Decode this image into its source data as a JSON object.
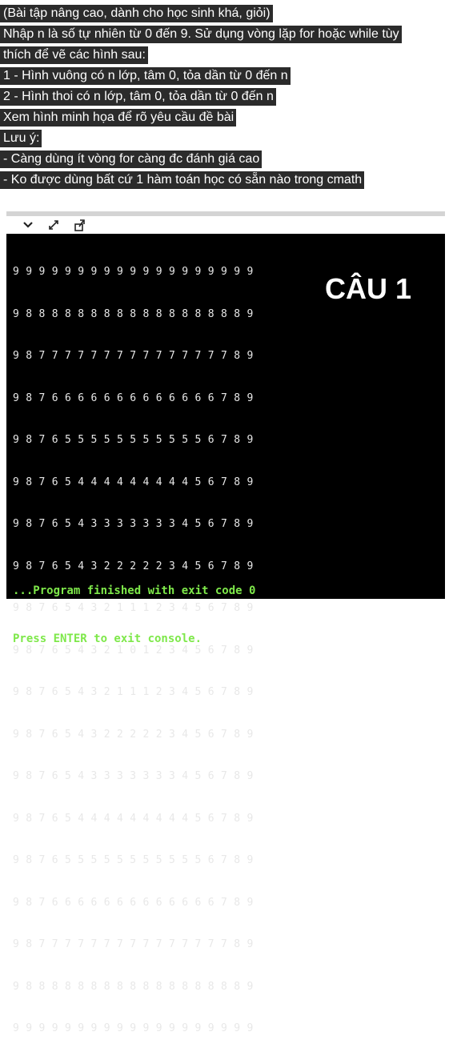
{
  "task": {
    "lines": [
      "(Bài tập nâng cao, dành cho học sinh khá, giỏi)",
      "Nhập n là số tự nhiên từ 0 đến 9. Sử dụng vòng lặp for hoặc while tùy",
      "thích để vẽ các hình sau:",
      "1 - Hình vuông có n lớp, tâm 0, tỏa dần từ 0 đến n",
      "2 - Hình thoi có n lớp, tâm 0, tỏa dần từ 0 đến n",
      "Xem hình minh họa để rõ yêu cầu đề bài",
      "Lưu ý:",
      "- Càng dùng ít vòng for càng đc đánh giá cao",
      "- Ko được dùng bất cứ 1 hàm toán học có sẵn nào trong cmath"
    ]
  },
  "toolbar": {
    "icons": [
      "chevron-down-icon",
      "expand-icon",
      "export-icon"
    ]
  },
  "console": {
    "label": "CÂU 1",
    "rows": [
      "9 9 9 9 9 9 9 9 9 9 9 9 9 9 9 9 9 9 9",
      "9 8 8 8 8 8 8 8 8 8 8 8 8 8 8 8 8 8 9",
      "9 8 7 7 7 7 7 7 7 7 7 7 7 7 7 7 7 8 9",
      "9 8 7 6 6 6 6 6 6 6 6 6 6 6 6 6 7 8 9",
      "9 8 7 6 5 5 5 5 5 5 5 5 5 5 5 6 7 8 9",
      "9 8 7 6 5 4 4 4 4 4 4 4 4 4 5 6 7 8 9",
      "9 8 7 6 5 4 3 3 3 3 3 3 3 4 5 6 7 8 9",
      "9 8 7 6 5 4 3 2 2 2 2 2 3 4 5 6 7 8 9",
      "9 8 7 6 5 4 3 2 1 1 1 2 3 4 5 6 7 8 9",
      "9 8 7 6 5 4 3 2 1 0 1 2 3 4 5 6 7 8 9",
      "9 8 7 6 5 4 3 2 1 1 1 2 3 4 5 6 7 8 9",
      "9 8 7 6 5 4 3 2 2 2 2 2 3 4 5 6 7 8 9",
      "9 8 7 6 5 4 3 3 3 3 3 3 3 4 5 6 7 8 9",
      "9 8 7 6 5 4 4 4 4 4 4 4 4 4 5 6 7 8 9",
      "9 8 7 6 5 5 5 5 5 5 5 5 5 5 5 6 7 8 9",
      "9 8 7 6 6 6 6 6 6 6 6 6 6 6 6 6 7 8 9",
      "9 8 7 7 7 7 7 7 7 7 7 7 7 7 7 7 7 8 9",
      "9 8 8 8 8 8 8 8 8 8 8 8 8 8 8 8 8 8 9",
      "9 9 9 9 9 9 9 9 9 9 9 9 9 9 9 9 9 9 9"
    ],
    "footer_line1": "...Program finished with exit code 0",
    "footer_line2": "Press ENTER to exit console."
  }
}
